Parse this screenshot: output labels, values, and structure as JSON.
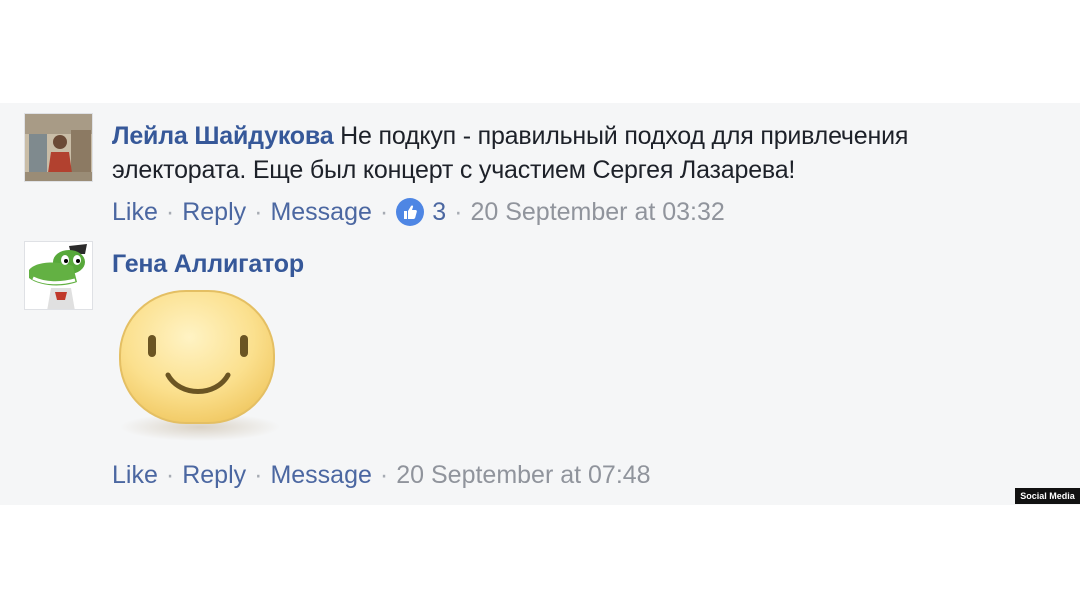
{
  "comments": [
    {
      "author": "Лейла Шайдукова",
      "text_line1": "Не подкуп - правильный подход для привлечения",
      "text_line2": "электората. Еще был концерт с участием Сергея Лазарева!",
      "actions": {
        "like": "Like",
        "reply": "Reply",
        "message": "Message"
      },
      "reaction_icon": "thumbs-up-icon",
      "like_count": "3",
      "timestamp": "20 September at 03:32"
    },
    {
      "author": "Гена Аллигатор",
      "sticker": "smiley-sticker",
      "actions": {
        "like": "Like",
        "reply": "Reply",
        "message": "Message"
      },
      "timestamp": "20 September at 07:48"
    }
  ],
  "watermark": "Social Media",
  "colors": {
    "author": "#365899",
    "action_link": "#4b67a1",
    "meta_gray": "#90949c",
    "panel_bg": "#f5f6f7",
    "like_badge": "#4e86e4"
  }
}
